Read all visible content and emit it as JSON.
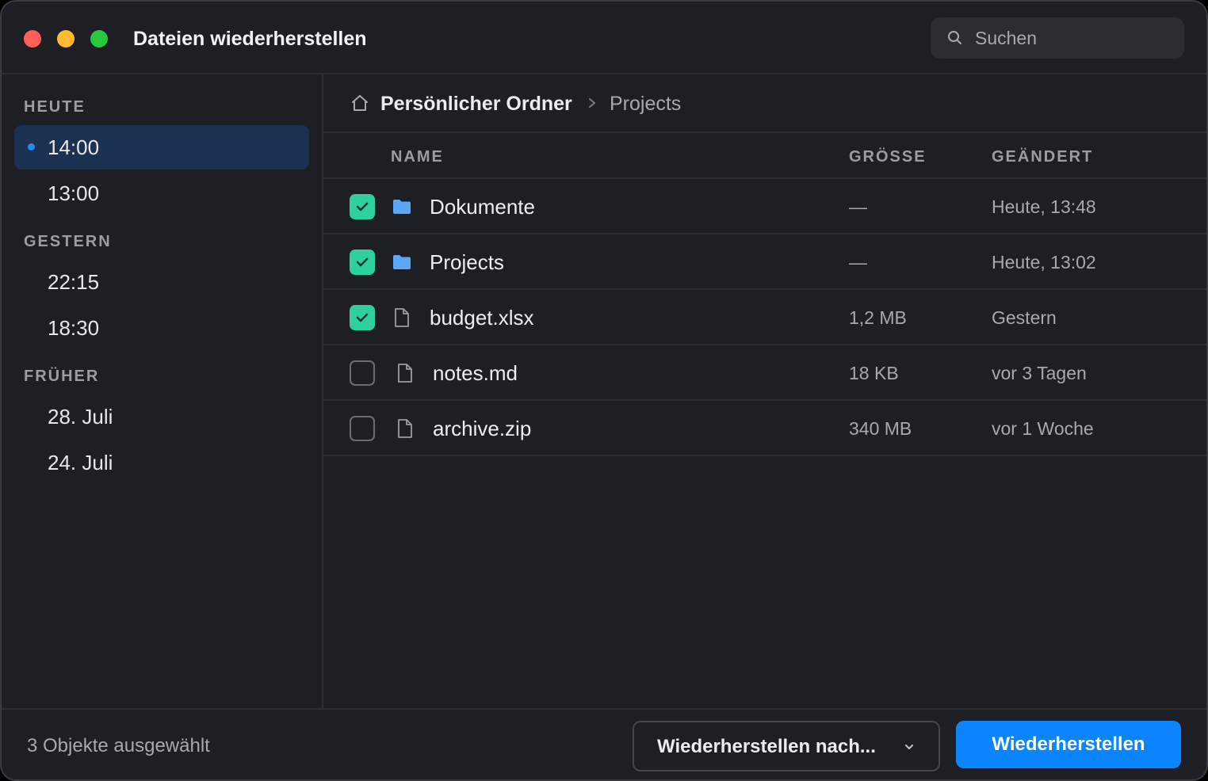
{
  "window": {
    "title": "Dateien wiederherstellen"
  },
  "search": {
    "placeholder": "Suchen",
    "value": ""
  },
  "sidebar": {
    "groups": [
      {
        "label": "HEUTE",
        "items": [
          {
            "label": "14:00",
            "active": true
          },
          {
            "label": "13:00"
          }
        ]
      },
      {
        "label": "GESTERN",
        "items": [
          {
            "label": "22:15"
          },
          {
            "label": "18:30"
          }
        ]
      },
      {
        "label": "FRÜHER",
        "items": [
          {
            "label": "28. Juli"
          },
          {
            "label": "24. Juli"
          }
        ]
      }
    ]
  },
  "breadcrumb": {
    "home": "Persönlicher Ordner",
    "current": "Projects"
  },
  "table": {
    "columns": {
      "name": "NAME",
      "size": "GRÖSSE",
      "modified": "GEÄNDERT"
    },
    "rows": [
      {
        "name": "Dokumente",
        "type": "folder",
        "size": "—",
        "modified": "Heute, 13:48",
        "checked": true
      },
      {
        "name": "Projects",
        "type": "folder",
        "size": "—",
        "modified": "Heute, 13:02",
        "checked": true
      },
      {
        "name": "budget.xlsx",
        "type": "file",
        "size": "1,2 MB",
        "modified": "Gestern",
        "checked": true
      },
      {
        "name": "notes.md",
        "type": "file",
        "size": "18 KB",
        "modified": "vor 3 Tagen",
        "checked": false
      },
      {
        "name": "archive.zip",
        "type": "file",
        "size": "340 MB",
        "modified": "vor 1 Woche",
        "checked": false
      }
    ]
  },
  "footer": {
    "selection_status": "3 Objekte ausgewählt",
    "restore_to_label": "Wiederherstellen nach...",
    "restore_label": "Wiederherstellen"
  },
  "icons": {
    "search": "search-icon",
    "home": "home-icon",
    "breadcrumb_separator": "chevron-right-icon",
    "folder": "folder-icon",
    "file": "document-icon",
    "check": "checkmark-icon",
    "dropdown": "chevron-down-icon"
  },
  "colors": {
    "window_bg": "#1e1f24",
    "accent": "#0a84ff",
    "selected_snapshot_bg": "#1b3252",
    "checkbox_checked": "#2ed0a0",
    "folder": "#5aa8f5",
    "close": "#ff5f57",
    "minimize": "#febc2e",
    "zoom": "#28c840"
  }
}
